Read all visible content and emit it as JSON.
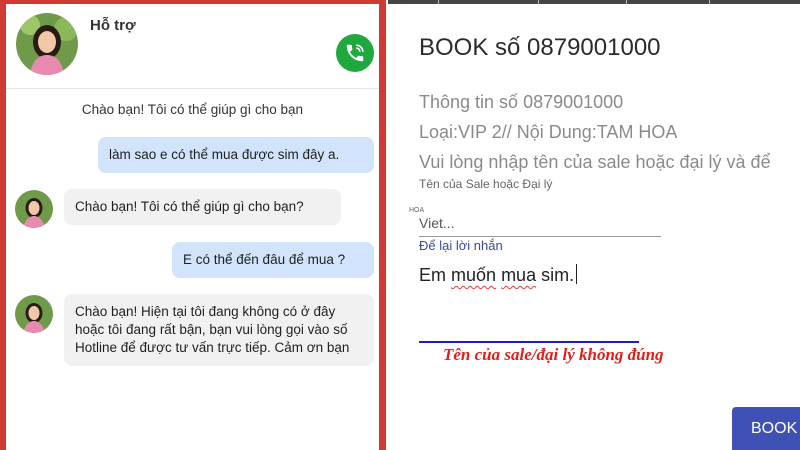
{
  "chat": {
    "title": "Hỗ trợ",
    "system_message": "Chào bạn! Tôi có thể giúp gì cho bạn",
    "messages": [
      {
        "sender": "user",
        "text": "làm sao e có thể mua được sim đây a."
      },
      {
        "sender": "agent",
        "text": "Chào bạn! Tôi có thể giúp gì cho bạn?"
      },
      {
        "sender": "user",
        "text": "E có thể đến đâu để mua ?"
      },
      {
        "sender": "agent",
        "text": "Chào bạn! Hiện tại tôi đang không có ở đây hoặc tôi đang rất bận, bạn vui lòng gọi vào số Hotline để được tư vấn trực tiếp. Cảm ơn bạn"
      }
    ],
    "icons": {
      "call": "phone-icon",
      "avatar": "agent-avatar"
    },
    "colors": {
      "frame": "#cf3b34",
      "user_bubble": "#d2e4fb",
      "agent_bubble": "#f1f1f1",
      "call_button": "#1fa83d"
    }
  },
  "booking": {
    "title": "BOOK số 0879001000",
    "info_number": "Thông tin số 0879001000",
    "info_type": "Loại:VIP 2// Nội Dung:TAM HOA",
    "instruction": "Vui lòng nhập tên của sale hoặc đại lý và để",
    "sale_label": "Tên của Sale hoặc Đại lý",
    "tiny_label": "HOA",
    "sale_value": "Viet...",
    "note_label": "Để lại lời nhắn",
    "note_value": {
      "part1": "Em ",
      "part2": "muốn",
      "part3": " ",
      "part4": "mua",
      "part5": " sim."
    },
    "error_annotation": "Tên của sale/đại lý không đúng",
    "submit_label": "BOOK",
    "colors": {
      "accent": "#3f51b5",
      "error": "#e01e1e",
      "link": "#3a4a9c"
    }
  }
}
